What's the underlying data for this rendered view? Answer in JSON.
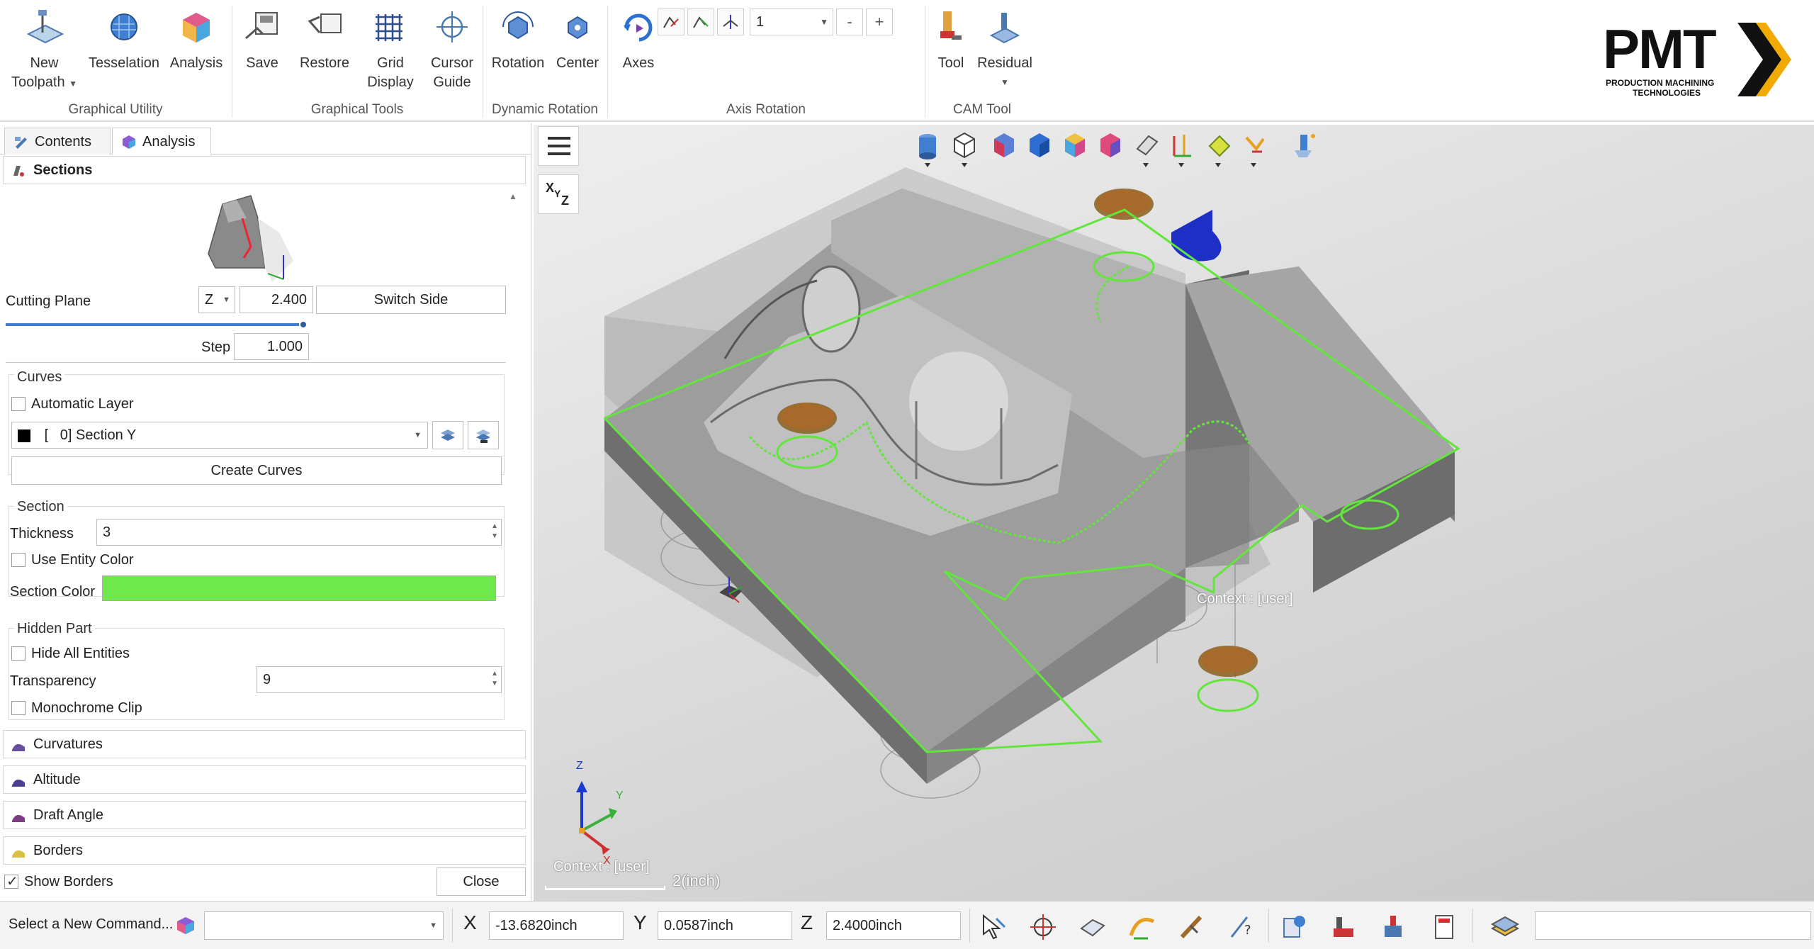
{
  "ribbon": {
    "groups": [
      {
        "label": "Graphical Utility",
        "buttons": [
          "New Toolpath",
          "Tesselation",
          "Analysis"
        ]
      },
      {
        "label": "Graphical Tools",
        "buttons": [
          "Save",
          "Restore",
          "Grid Display",
          "Cursor Guide"
        ]
      },
      {
        "label": "Dynamic Rotation",
        "buttons": [
          "Rotation",
          "Center"
        ]
      },
      {
        "label": "Axis Rotation",
        "buttons": [
          "Axes"
        ]
      },
      {
        "label": "CAM Tool",
        "buttons": [
          "Tool",
          "Residual"
        ]
      }
    ],
    "new_toolpath_line1": "New",
    "new_toolpath_line2": "Toolpath",
    "grid_line1": "Grid",
    "grid_line2": "Display",
    "cursor_line1": "Cursor",
    "cursor_line2": "Guide",
    "axis_value": "1",
    "minus": "-",
    "plus": "+"
  },
  "logo": {
    "name": "PMT",
    "tagline_1": "PRODUCTION MACHINING",
    "tagline_2": "TECHNOLOGIES",
    "accent": "#f2a900"
  },
  "panel": {
    "tabs": [
      "Contents",
      "Analysis"
    ],
    "active_tab": "Analysis",
    "sections_title": "Sections",
    "cutting_plane_label": "Cutting Plane",
    "cutting_axis": "Z",
    "cutting_value": "2.400",
    "switch_side": "Switch Side",
    "slider_fraction": 1.0,
    "step_label": "Step",
    "step_value": "1.000",
    "curves_title": "Curves",
    "automatic_layer": "Automatic Layer",
    "automatic_layer_checked": false,
    "layer_value": "[   0] Section Y",
    "create_curves": "Create Curves",
    "section_title": "Section",
    "thickness_label": "Thickness",
    "thickness_value": "3",
    "use_entity_color": "Use Entity Color",
    "use_entity_color_checked": false,
    "section_color_label": "Section Color",
    "section_color": "#6ee84a",
    "hidden_part_title": "Hidden Part",
    "hide_all": "Hide All Entities",
    "hide_all_checked": false,
    "transparency_label": "Transparency",
    "transparency_value": "9",
    "monochrome": "Monochrome Clip",
    "monochrome_checked": false,
    "collapsed_sections": [
      "Curvatures",
      "Altitude",
      "Draft Angle",
      "Borders"
    ],
    "show_borders": "Show Borders",
    "show_borders_checked": true,
    "close": "Close"
  },
  "viewport": {
    "context_label": "Context : [user]",
    "axis_context_label": "Context : [user]",
    "scale_label": "2(inch)",
    "axis_x": "X",
    "axis_y": "Y",
    "axis_z": "Z",
    "xyz_button": "XYZ"
  },
  "status": {
    "prompt": "Select a New Command...",
    "x_label": "X",
    "x_value": "-13.6820inch",
    "y_label": "Y",
    "y_value": "0.0587inch",
    "z_label": "Z",
    "z_value": "2.4000inch"
  }
}
